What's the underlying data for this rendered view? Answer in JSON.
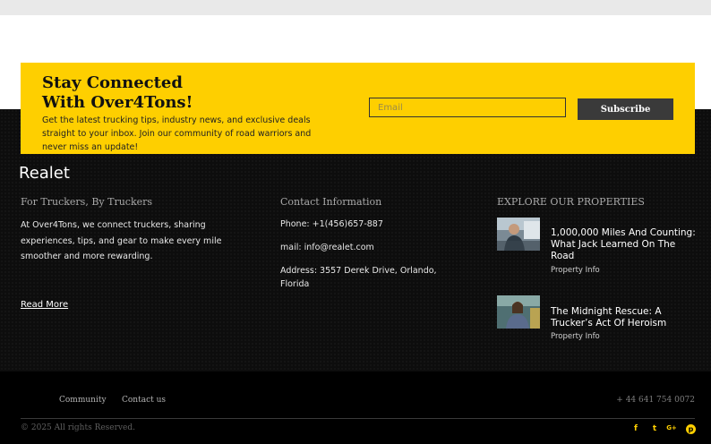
{
  "newsletter": {
    "title_line1": "Stay Connected",
    "title_line2": "With Over4Tons!",
    "text": "Get the latest trucking tips, industry news, and exclusive deals straight to your inbox. Join our community of road warriors and never miss an update!",
    "email_placeholder": "Email",
    "subscribe_label": "Subscribe"
  },
  "footer": {
    "brand": "Realet",
    "about": {
      "heading": "For Truckers, By Truckers",
      "text": "At Over4Tons, we connect truckers, sharing experiences, tips, and gear to make every mile smoother and more rewarding.",
      "read_more": "Read More"
    },
    "contact": {
      "heading": "Contact Information",
      "phone": "Phone: +1(456)657-887",
      "mail": "mail: info@realet.com",
      "address": "Address: 3557 Derek Drive, Orlando, Florida"
    },
    "properties": {
      "heading": "EXPLORE OUR PROPERTIES",
      "posts": [
        {
          "title": "1,000,000 Miles And Counting: What Jack Learned On The Road",
          "category": "Property Info"
        },
        {
          "title": "The Midnight Rescue: A Trucker’s Act Of Heroism",
          "category": "Property Info"
        }
      ]
    }
  },
  "bottom": {
    "nav": [
      "Community",
      "Contact us"
    ],
    "phone": "+ 44 641 754 0072",
    "copyright": "© 2025 All rights Reserved.",
    "social": {
      "facebook": "f",
      "twitter": "t",
      "google": "G+",
      "pinterest": "p"
    }
  },
  "colors": {
    "accent": "#fecf00",
    "dark": "#0d0d0d",
    "button": "#3a3a3a"
  }
}
